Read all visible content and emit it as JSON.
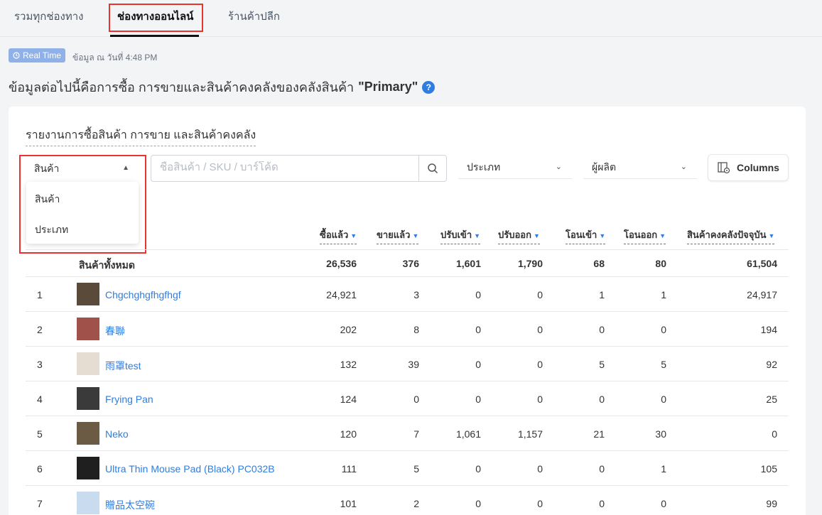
{
  "tabs": [
    {
      "label": "รวมทุกช่องทาง"
    },
    {
      "label": "ช่องทางออนไลน์"
    },
    {
      "label": "ร้านค้าปลีก"
    }
  ],
  "realtime": {
    "badge": "Real Time",
    "timestamp": "ข้อมูล ณ วันที่ 4:48 PM"
  },
  "heading": {
    "prefix": "ข้อมูลต่อไปนี้คือการซื้อ การขายและสินค้าคงคลังของคลังสินค้า",
    "warehouse": "\"Primary\"",
    "help_icon": "?"
  },
  "report": {
    "title": "รายงานการซื้อสินค้า การขาย และสินค้าคงคลัง"
  },
  "toolbar": {
    "group_by": {
      "value": "สินค้า",
      "options": [
        "สินค้า",
        "ประเภท"
      ]
    },
    "search_placeholder": "ชื่อสินค้า / SKU / บาร์โค้ด",
    "category_filter": "ประเภท",
    "manufacturer_filter": "ผู้ผลิต",
    "columns_label": "Columns"
  },
  "table": {
    "columns": [
      "ซื้อแล้ว",
      "ขายแล้ว",
      "ปรับเข้า",
      "ปรับออก",
      "โอนเข้า",
      "โอนออก",
      "สินค้าคงคลังปัจจุบัน"
    ],
    "total": {
      "label": "สินค้าทั้งหมด",
      "values": [
        "26,536",
        "376",
        "1,601",
        "1,790",
        "68",
        "80",
        "61,504"
      ]
    },
    "rows": [
      {
        "num": "1",
        "name": "Chgchghgfhgfhgf",
        "thumb": "#5a4a3a",
        "values": [
          "24,921",
          "3",
          "0",
          "0",
          "1",
          "1",
          "24,917"
        ]
      },
      {
        "num": "2",
        "name": "春聯",
        "thumb": "#a0524a",
        "values": [
          "202",
          "8",
          "0",
          "0",
          "0",
          "0",
          "194"
        ]
      },
      {
        "num": "3",
        "name": "雨罩test",
        "thumb": "#e6ddd2",
        "values": [
          "132",
          "39",
          "0",
          "0",
          "5",
          "5",
          "92"
        ]
      },
      {
        "num": "4",
        "name": "Frying Pan",
        "thumb": "#3a3a3a",
        "values": [
          "124",
          "0",
          "0",
          "0",
          "0",
          "0",
          "25"
        ]
      },
      {
        "num": "5",
        "name": "Neko",
        "thumb": "#6b5a44",
        "values": [
          "120",
          "7",
          "1,061",
          "1,157",
          "21",
          "30",
          "0"
        ]
      },
      {
        "num": "6",
        "name": "Ultra Thin Mouse Pad (Black) PC032B",
        "thumb": "#1f1f1f",
        "values": [
          "111",
          "5",
          "0",
          "0",
          "0",
          "1",
          "105"
        ]
      },
      {
        "num": "7",
        "name": "贈品太空碗",
        "thumb": "#c9dcef",
        "values": [
          "101",
          "2",
          "0",
          "0",
          "0",
          "0",
          "99"
        ]
      }
    ]
  }
}
